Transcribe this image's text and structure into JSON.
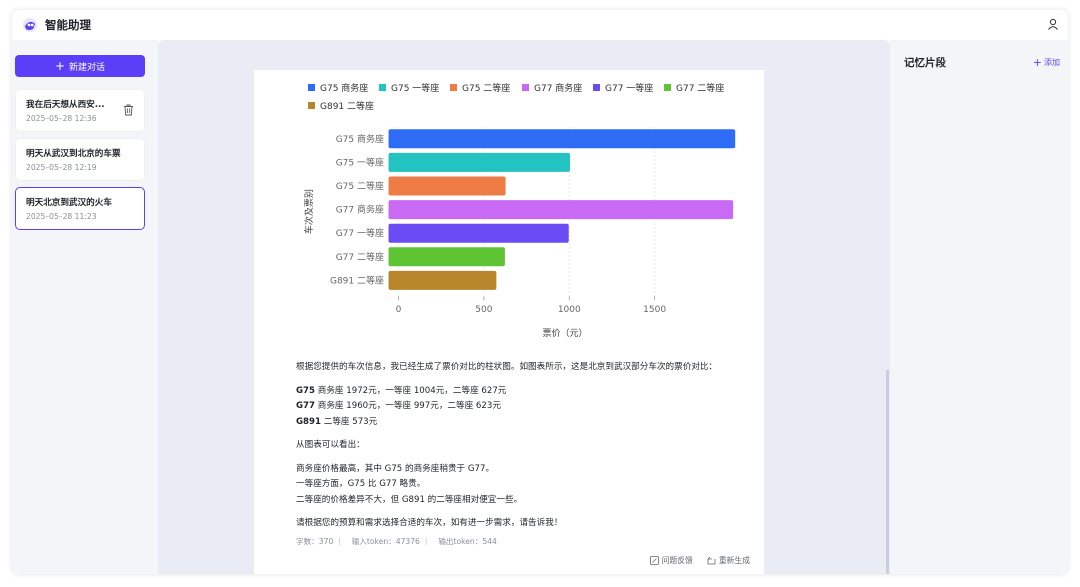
{
  "app": {
    "title": "智能助理"
  },
  "sidebar": {
    "new_chat_label": "新建对话",
    "conversations": [
      {
        "title": "我在后天想从西安...",
        "time": "2025–05–28 12:36"
      },
      {
        "title": "明天从武汉到北京的车票",
        "time": "2025–05–28 12:19"
      },
      {
        "title": "明天北京到武汉的火车",
        "time": "2025–05–28 11:23"
      }
    ]
  },
  "right_panel": {
    "title": "记忆片段",
    "add_label": "添加"
  },
  "chart_data": {
    "type": "bar",
    "orientation": "horizontal",
    "categories": [
      "G75 商务座",
      "G75 一等座",
      "G75 二等座",
      "G77 商务座",
      "G77 一等座",
      "G77 二等座",
      "G891 二等座"
    ],
    "values": [
      1972,
      1004,
      627,
      1960,
      997,
      623,
      573
    ],
    "colors": [
      "#2f6cf5",
      "#22c3c0",
      "#ee7d45",
      "#c96af5",
      "#6a4cf5",
      "#5ec434",
      "#b8862a"
    ],
    "legend": [
      "G75 商务座",
      "G75 一等座",
      "G75 二等座",
      "G77 商务座",
      "G77 一等座",
      "G77 二等座",
      "G891 二等座"
    ],
    "legend_position": "top",
    "xlabel": "票价（元）",
    "ylabel": "车次及票别",
    "xlim": [
      -50,
      2000
    ],
    "xticks": [
      0,
      500,
      1000,
      1500
    ],
    "grid": "vertical dashed"
  },
  "answer": {
    "intro": "根据您提供的车次信息，我已经生成了票价对比的柱状图。如图表所示，这是北京到武汉部分车次的票价对比：",
    "prices": [
      {
        "train": "G75",
        "detail": " 商务座 1972元，一等座 1004元，二等座 627元"
      },
      {
        "train": "G77",
        "detail": " 商务座 1960元，一等座 997元，二等座 623元"
      },
      {
        "train": "G891",
        "detail": " 二等座 573元"
      }
    ],
    "observe": "从图表可以看出：",
    "points": [
      "商务座价格最高，其中 G75 的商务座稍贵于 G77。",
      "一等座方面，G75 比 G77 略贵。",
      "二等座的价格差异不大，但 G891 的二等座相对便宜一些。"
    ],
    "closing": "请根据您的预算和需求选择合适的车次，如有进一步需求，请告诉我！",
    "meta": {
      "chars": "字数：370 ｜",
      "input": "输入token：47376 ｜",
      "output": "输出token：544"
    },
    "feedback_label": "问题反馈",
    "regen_label": "重新生成"
  }
}
